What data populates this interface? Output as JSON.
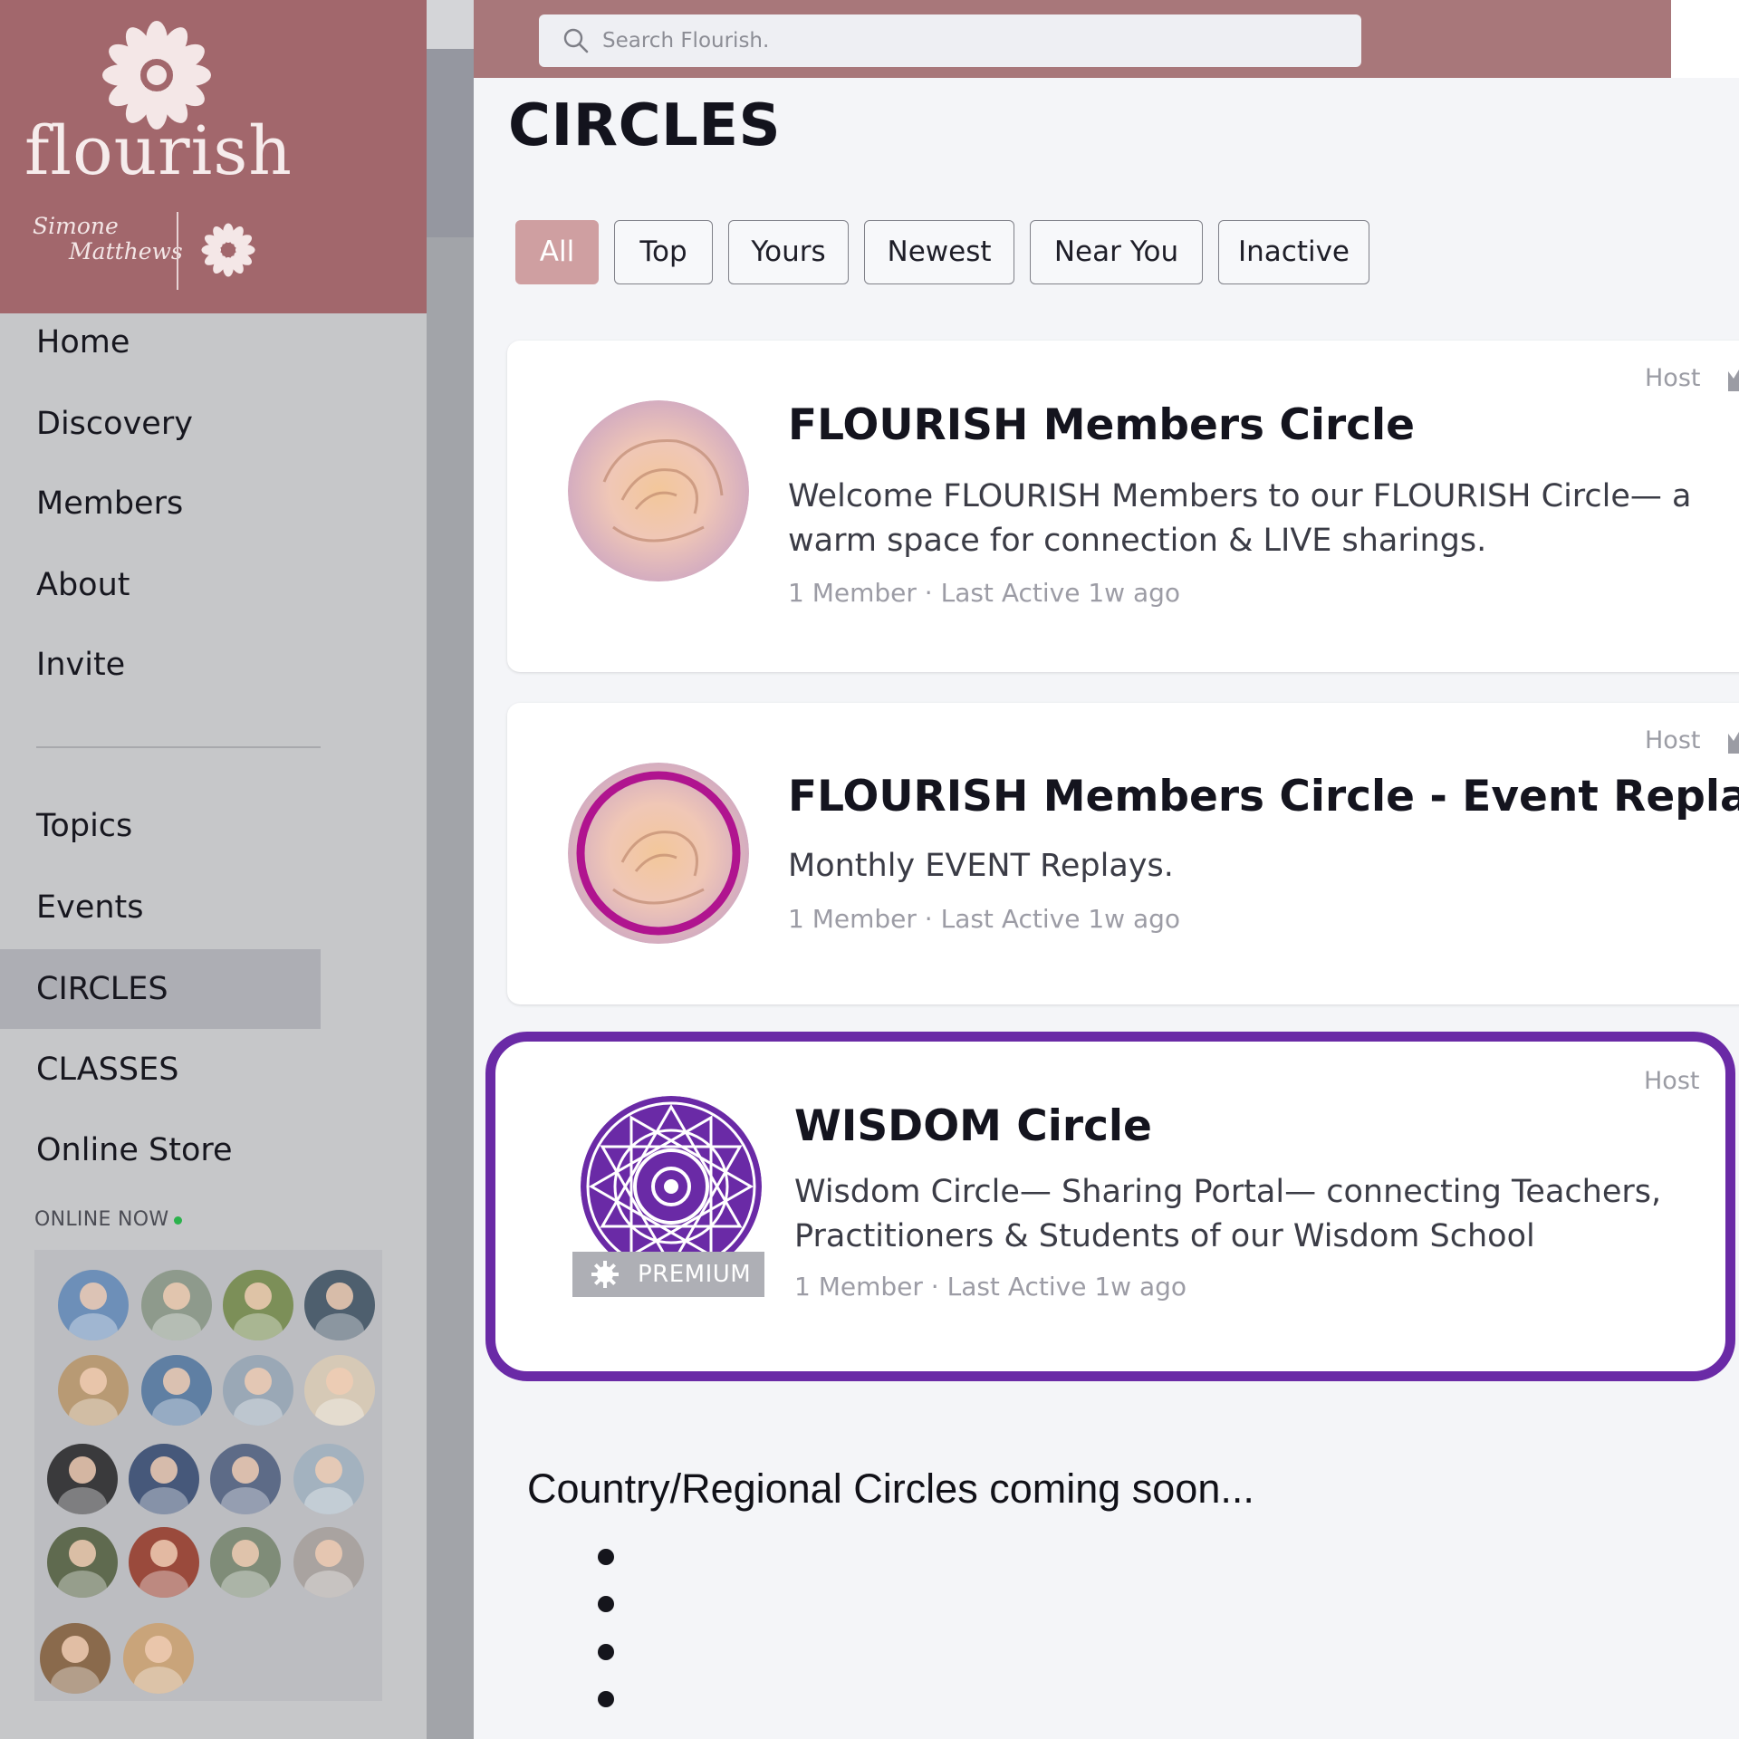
{
  "brand": {
    "wordmark": "flourish",
    "signature_line1": "Simone",
    "signature_line2": "Matthews",
    "accent_color": "#a2676c"
  },
  "search": {
    "placeholder": "Search Flourish.",
    "value": ""
  },
  "sidebar": {
    "primary_items": [
      {
        "label": "Home"
      },
      {
        "label": "Discovery"
      },
      {
        "label": "Members"
      },
      {
        "label": "About"
      },
      {
        "label": "Invite"
      }
    ],
    "secondary_items": [
      {
        "label": "Topics"
      },
      {
        "label": "Events"
      },
      {
        "label": "CIRCLES",
        "active": true
      },
      {
        "label": "CLASSES"
      },
      {
        "label": "Online Store"
      }
    ],
    "online_now_label": "ONLINE NOW",
    "online_avatar_count": 18
  },
  "page": {
    "title": "CIRCLES"
  },
  "filters": [
    {
      "label": "All",
      "active": true
    },
    {
      "label": "Top"
    },
    {
      "label": "Yours"
    },
    {
      "label": "Newest"
    },
    {
      "label": "Near You"
    },
    {
      "label": "Inactive"
    }
  ],
  "circles": [
    {
      "role": "Host",
      "title": "FLOURISH Members Circle",
      "description": "Welcome FLOURISH Members to our FLOURISH Circle— a warm space for connection & LIVE sharings.",
      "meta": "1 Member · Last Active 1w ago",
      "icon": "rose-image"
    },
    {
      "role": "Host",
      "title": "FLOURISH Members Circle - Event Replays",
      "description": "Monthly EVENT Replays.",
      "meta": "1 Member · Last Active 1w ago",
      "icon": "rose-image-ringed",
      "ring_color": "#b0148f"
    },
    {
      "role": "Host",
      "title": "WISDOM Circle",
      "description": "Wisdom Circle— Sharing Portal— connecting Teachers, Practitioners & Students of our Wisdom School",
      "meta": "1 Member · Last Active 1w ago",
      "icon": "mandala-icon",
      "badge": "PREMIUM",
      "highlighted": true,
      "highlight_color": "#6a2aa6"
    }
  ],
  "coming_soon": {
    "text": "Country/Regional Circles coming soon...",
    "bullet_count": 4
  }
}
